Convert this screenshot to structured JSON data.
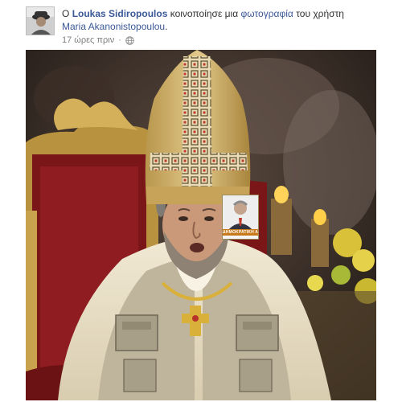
{
  "header": {
    "prefix": "Ο",
    "author_name": "Loukas Sidiropoulos",
    "action_text": "κοινοποίησε μια",
    "object_link": "φωτογραφία",
    "object_suffix": "του χρήστη",
    "original_author": "Maria Akanonistopoulou",
    "end_punct": "."
  },
  "meta": {
    "timestamp": "17 ώρες πριν",
    "privacy_icon": "globe-icon"
  },
  "photo": {
    "badge_text": "ΔΗΜΟΚΡΑΤΙΚΗ ΑΡΙΣΤΕΡΑ"
  },
  "colors": {
    "link": "#3b5998",
    "meta": "#7f7f7f"
  }
}
